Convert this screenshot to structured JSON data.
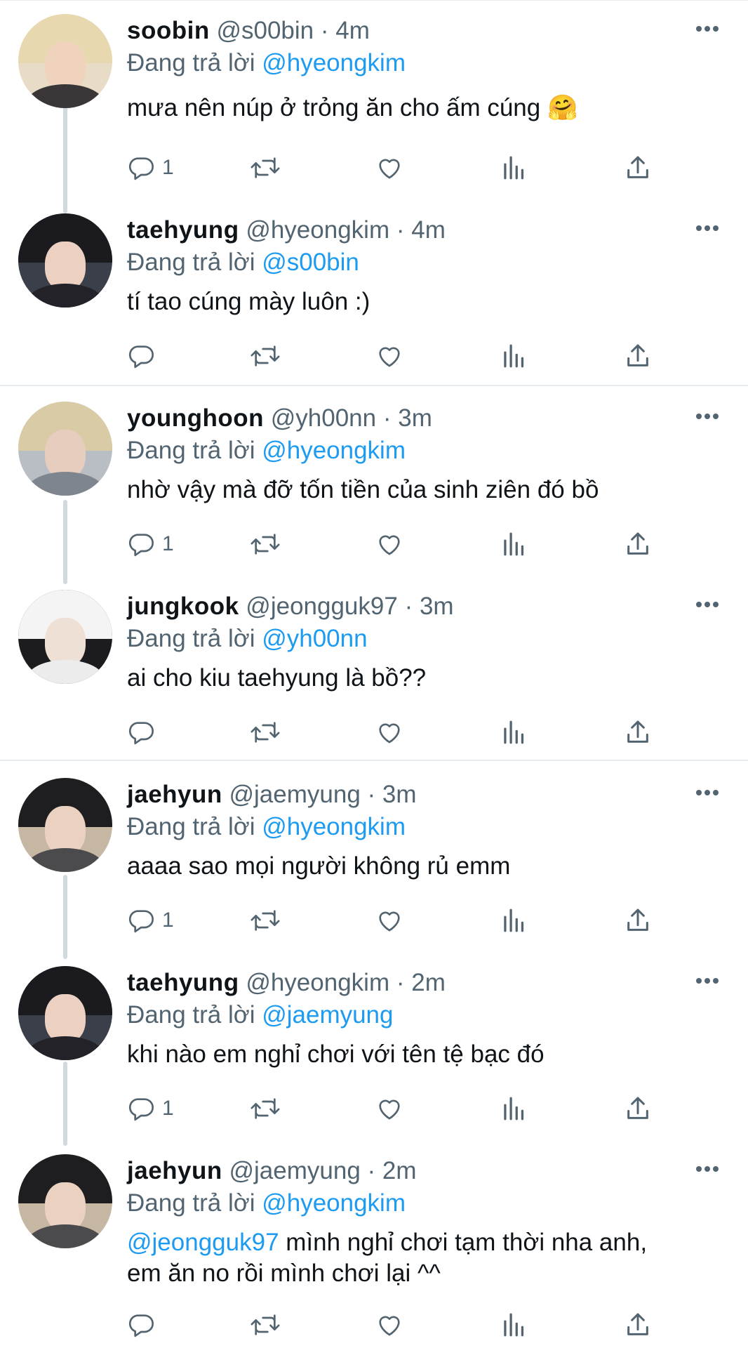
{
  "reply_prefix": "Đang trả lời",
  "more_label": "More",
  "tweets": [
    {
      "name": "soobin",
      "handle": "@s00bin",
      "time": "4m",
      "reply_to": "@hyeongkim",
      "text": "mưa nên núp ở trỏng ăn cho ấm cúng 🤗",
      "mention": "",
      "text2": "",
      "reply_count": "1"
    },
    {
      "name": "taehyung",
      "handle": "@hyeongkim",
      "time": "4m",
      "reply_to": "@s00bin",
      "text": "tí tao cúng mày luôn :)",
      "mention": "",
      "text2": "",
      "reply_count": ""
    },
    {
      "name": "younghoon",
      "handle": "@yh00nn",
      "time": "3m",
      "reply_to": "@hyeongkim",
      "text": "nhờ vậy mà đỡ tốn tiền của sinh ziên đó bồ",
      "mention": "",
      "text2": "",
      "reply_count": "1"
    },
    {
      "name": "jungkook",
      "handle": "@jeongguk97",
      "time": "3m",
      "reply_to": "@yh00nn",
      "text": "ai cho kiu taehyung là bồ??",
      "mention": "",
      "text2": "",
      "reply_count": ""
    },
    {
      "name": "jaehyun",
      "handle": "@jaemyung",
      "time": "3m",
      "reply_to": "@hyeongkim",
      "text": "aaaa sao mọi người không rủ emm",
      "mention": "",
      "text2": "",
      "reply_count": "1"
    },
    {
      "name": "taehyung",
      "handle": "@hyeongkim",
      "time": "2m",
      "reply_to": "@jaemyung",
      "text": "khi nào em nghỉ chơi với tên tệ bạc đó",
      "mention": "",
      "text2": "",
      "reply_count": "1"
    },
    {
      "name": "jaehyun",
      "handle": "@jaemyung",
      "time": "2m",
      "reply_to": "@hyeongkim",
      "text": " mình nghỉ chơi tạm thời nha anh,",
      "mention": "@jeongguk97",
      "text2": "em ăn no rồi mình chơi lại ^^",
      "reply_count": ""
    }
  ],
  "colors": {
    "text": "#0f1419",
    "secondary": "#536471",
    "link": "#1d9bf0",
    "divider": "#e6ecf0",
    "thread_line": "#cfd9de"
  }
}
